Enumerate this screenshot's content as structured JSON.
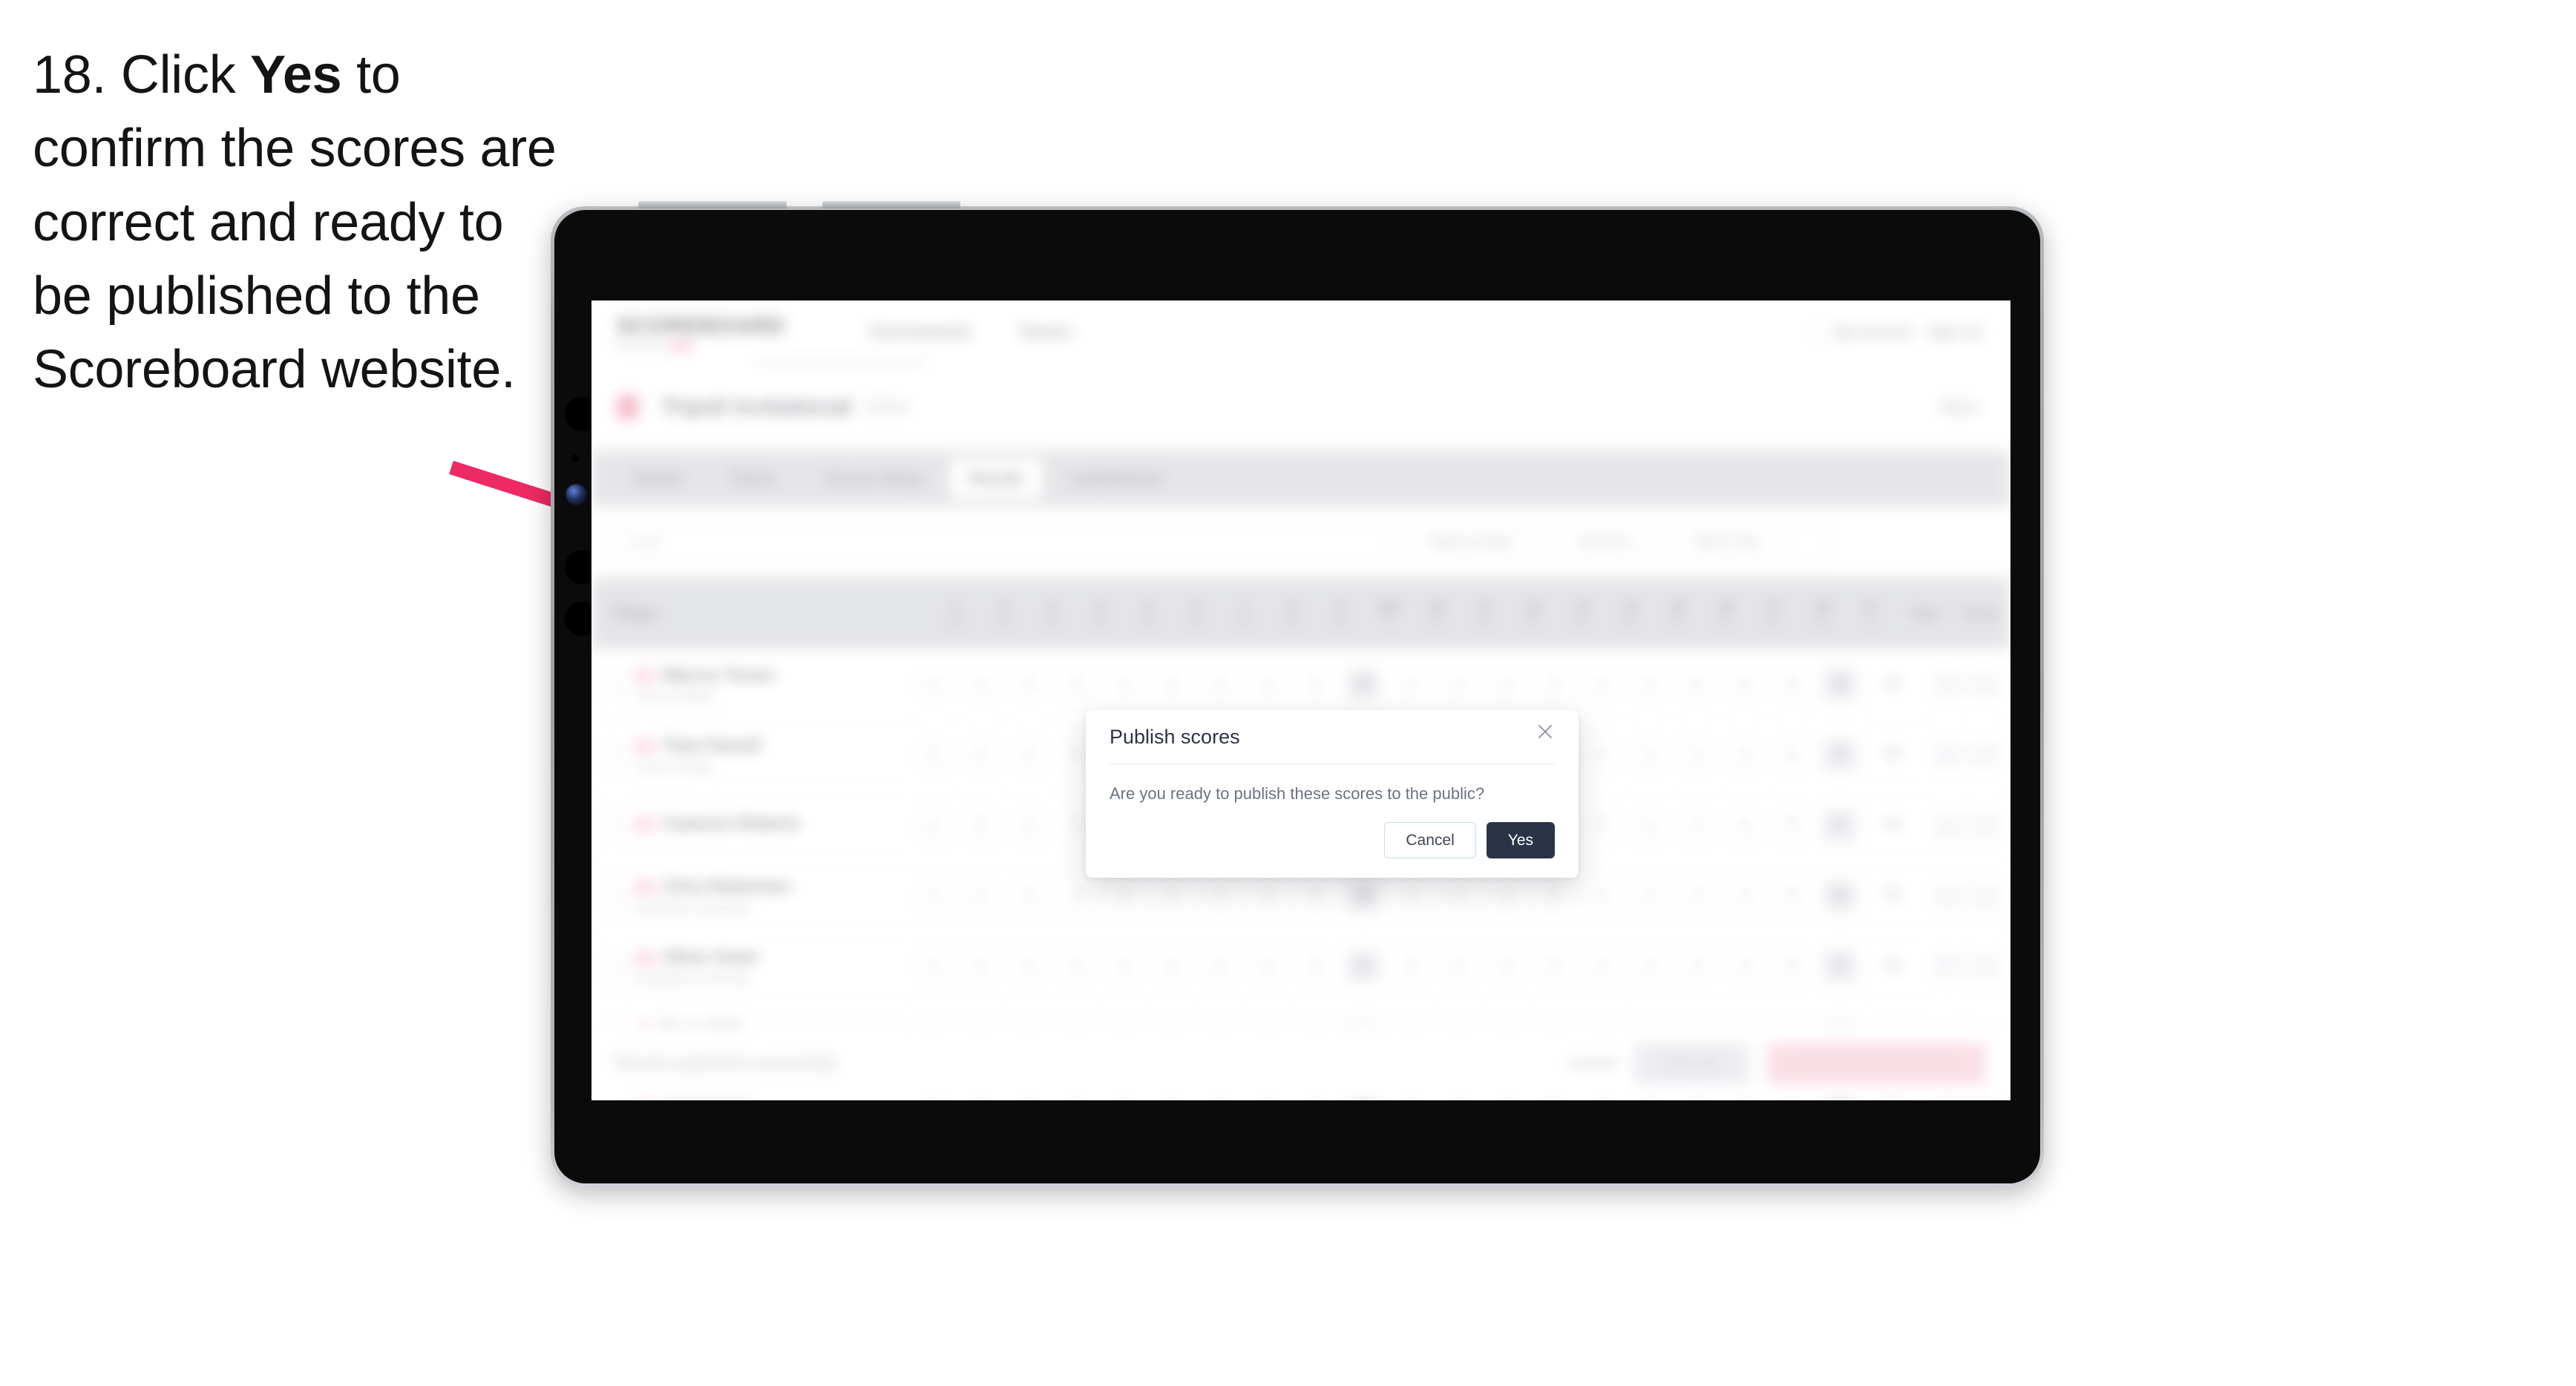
{
  "caption": {
    "number": "18.",
    "before_bold": " Click ",
    "bold": "Yes",
    "after_bold": " to confirm the scores are correct and ready to be published to the Scoreboard website.",
    "full": "18. Click Yes to confirm the scores are correct and ready to be published to the Scoreboard website."
  },
  "annotation": {
    "arrow_color": "#ED2A63",
    "arrow_name": "callout-arrow"
  },
  "device": {
    "type": "tablet",
    "frame_color": "#0B0B0C",
    "edge_color": "#A7AAAE"
  },
  "app": {
    "topnav": {
      "wordmark": "SCOREBOARD",
      "tagline": "Powered by",
      "tagline_accent": "NEW",
      "links": [
        "Tournaments",
        "Teams"
      ],
      "account": "My Account",
      "signout": "Sign out"
    },
    "breadcrumb": {
      "title": "Tripoli Invitational",
      "subtitle": "2024",
      "action": "Back"
    },
    "tabs": [
      {
        "label": "Details",
        "active": false
      },
      {
        "label": "Teams",
        "active": false
      },
      {
        "label": "Course Setup",
        "active": false
      },
      {
        "label": "Results",
        "active": true
      },
      {
        "label": "Leaderboard",
        "active": false
      }
    ],
    "filters": {
      "search_placeholder": "Find",
      "pills": [
        "Flight number",
        "Round 1",
        "Team Only"
      ]
    },
    "table": {
      "player_header": "Player",
      "hole_headers": [
        {
          "n": "1",
          "p": "Par 4"
        },
        {
          "n": "2",
          "p": "Par 4"
        },
        {
          "n": "3",
          "p": "Par 3"
        },
        {
          "n": "4",
          "p": "Par 5"
        },
        {
          "n": "5",
          "p": "Par 4"
        },
        {
          "n": "6",
          "p": "Par 4"
        },
        {
          "n": "7",
          "p": "Par 3"
        },
        {
          "n": "8",
          "p": "Par 4"
        },
        {
          "n": "9",
          "p": "Par 5"
        },
        {
          "n": "Out",
          "p": "36"
        },
        {
          "n": "10",
          "p": "Par 4"
        },
        {
          "n": "11",
          "p": "Par 4"
        },
        {
          "n": "12",
          "p": "Par 3"
        },
        {
          "n": "13",
          "p": "Par 5"
        },
        {
          "n": "14",
          "p": "Par 4"
        },
        {
          "n": "15",
          "p": "Par 4"
        },
        {
          "n": "16",
          "p": "Par 3"
        },
        {
          "n": "17",
          "p": "Par 4"
        },
        {
          "n": "18",
          "p": "Par 5"
        },
        {
          "n": "In",
          "p": "36"
        }
      ],
      "end_headers": [
        "Total",
        "Score"
      ],
      "rows": [
        {
          "name": "Marcus Turner",
          "team": "Coast College",
          "scores": [
            "4",
            "4",
            "3",
            "5",
            "4",
            "4",
            "3",
            "4",
            "5",
            "36",
            "4",
            "4",
            "3",
            "5",
            "4",
            "4",
            "3",
            "4",
            "5",
            "36"
          ],
          "total": "72",
          "score": "E"
        },
        {
          "name": "Theo Parnell",
          "team": "Coast College",
          "scores": [
            "5",
            "4",
            "3",
            "5",
            "4",
            "5",
            "3",
            "4",
            "5",
            "38",
            "4",
            "4",
            "4",
            "5",
            "4",
            "4",
            "3",
            "4",
            "5",
            "37"
          ],
          "total": "75",
          "score": "+3"
        },
        {
          "name": "Cameron Roberts",
          "team": "",
          "scores": [
            "4",
            "5",
            "3",
            "5",
            "4",
            "4",
            "3",
            "5",
            "5",
            "38",
            "4",
            "4",
            "3",
            "5",
            "5",
            "4",
            "3",
            "4",
            "5",
            "37"
          ],
          "total": "75",
          "score": "+3"
        },
        {
          "name": "Chris Robertson",
          "team": "Southland University",
          "scores": [
            "4",
            "4",
            "3",
            "5",
            "4",
            "4",
            "3",
            "4",
            "5",
            "36",
            "4",
            "4",
            "3",
            "5",
            "4",
            "4",
            "3",
            "4",
            "5",
            "36"
          ],
          "total": "72",
          "score": "E"
        },
        {
          "name": "Oliver Grant",
          "team": "Southland University",
          "scores": [
            "4",
            "4",
            "4",
            "5",
            "4",
            "4",
            "3",
            "4",
            "5",
            "37",
            "5",
            "4",
            "3",
            "5",
            "4",
            "4",
            "3",
            "4",
            "5",
            "37"
          ],
          "total": "74",
          "score": "+2"
        },
        {
          "name": "Ryan Britt",
          "team": "Southland University",
          "scores": [
            "4",
            "5",
            "3",
            "5",
            "4",
            "4",
            "3",
            "4",
            "5",
            "37",
            "4",
            "4",
            "3",
            "5",
            "4",
            "4",
            "4",
            "4",
            "5",
            "37"
          ],
          "total": "74",
          "score": "+2"
        },
        {
          "name": "Nick Bailey",
          "team": "Southland University",
          "scores": [
            "4",
            "4",
            "3",
            "5",
            "4",
            "4",
            "3",
            "4",
            "5",
            "36",
            "4",
            "4",
            "3",
            "5",
            "4",
            "4",
            "3",
            "4",
            "5",
            "36"
          ],
          "total": "72",
          "score": "E"
        }
      ]
    },
    "footer": {
      "note": "Results published successfully",
      "link": "Cancel",
      "secondary_button": "Save all",
      "primary_button": "Publish scores to public"
    }
  },
  "modal": {
    "title": "Publish scores",
    "body": "Are you ready to publish these scores to the public?",
    "cancel_label": "Cancel",
    "confirm_label": "Yes",
    "close_icon": "close-icon",
    "confirm_color": "#2B3446",
    "cancel_border_color": "#C5D9F1"
  }
}
